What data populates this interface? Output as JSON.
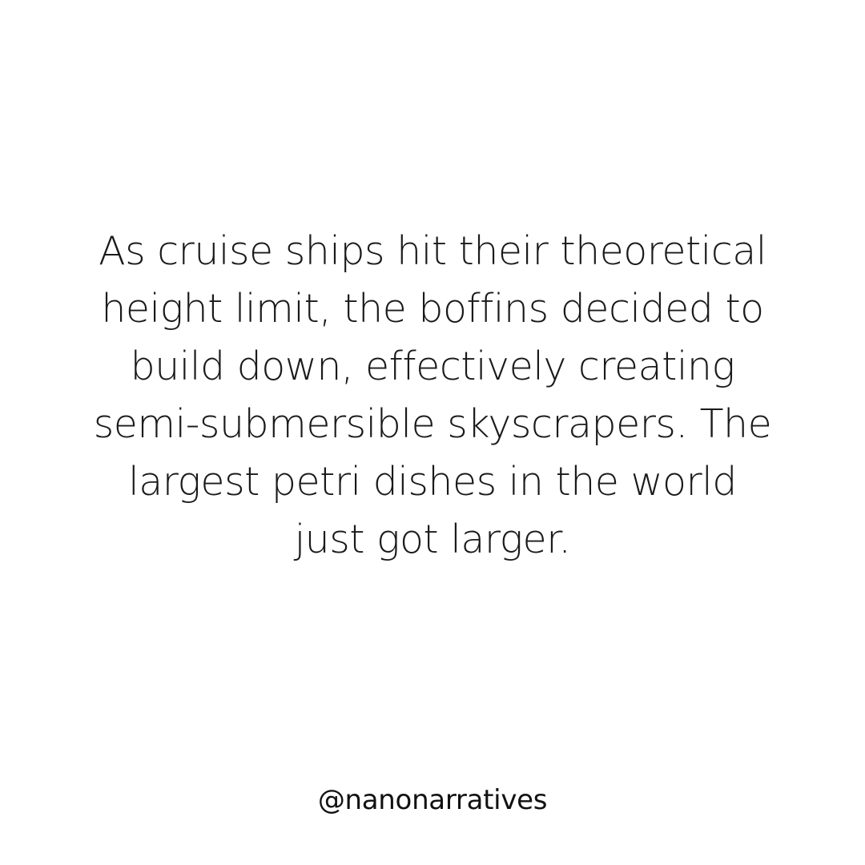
{
  "post": {
    "lines": [
      "As cruise ships hit their theoretical",
      "height limit, the boffins decided to",
      "build down, effectively creating",
      "semi-submersible skyscrapers. The",
      "largest petri dishes in the world",
      "just got larger."
    ],
    "handle": "@nanonarratives"
  },
  "colors": {
    "background": "#ffffff",
    "text": "#1a1a1a"
  }
}
